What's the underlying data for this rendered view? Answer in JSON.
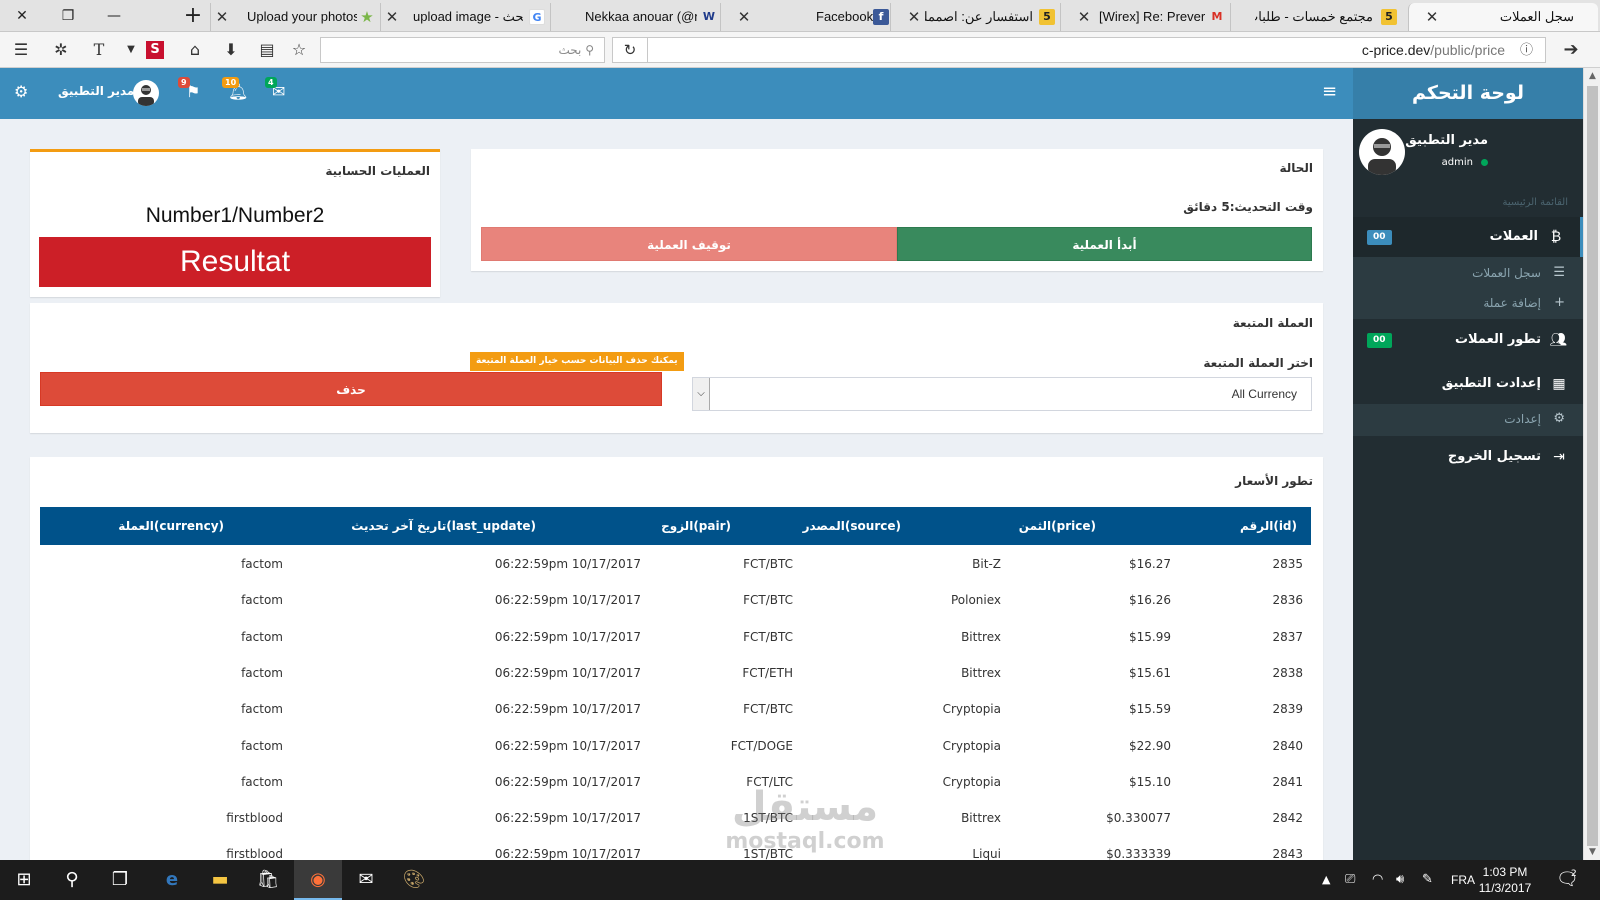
{
  "browser": {
    "tabs": [
      {
        "title": "سجل العملات",
        "active": true
      },
      {
        "title": "مجتمع خمسات - طلبات",
        "favicon": "5"
      },
      {
        "title": "[Wirex] Re: Preverifica",
        "favicon": "M"
      },
      {
        "title": "استفسار عن: اصمملك",
        "favicon": "5"
      },
      {
        "title": "Facebook",
        "favicon": "f"
      },
      {
        "title": "Nekkaa anouar (@ne",
        "favicon": "W"
      },
      {
        "title": "upload image - بحث",
        "favicon": "G"
      },
      {
        "title": "Upload your photos",
        "favicon": "★"
      }
    ],
    "search_placeholder": "بحث",
    "url_main": "c-price.dev",
    "url_path": "/public/price"
  },
  "header": {
    "user_name": "مدير التطبيق",
    "badges": {
      "messages": "4",
      "notifications": "10",
      "flags": "9"
    }
  },
  "brand": "لوحة التحكم",
  "sidebar": {
    "user_name": "مدير التطبيق",
    "user_role": "admin",
    "section_heading": "القائمة الرئيسية",
    "items": [
      {
        "label": "العملات",
        "badge": "00",
        "badge_color": "#3c8dbc"
      },
      {
        "label": "سجل العملات"
      },
      {
        "label": "إضافة عملة"
      },
      {
        "label": "تطور العملات",
        "badge": "00",
        "badge_color": "#00a65a"
      },
      {
        "label": "إعدادت التطبيق"
      },
      {
        "label": "إعدادت"
      },
      {
        "label": "تسجيل الخروج"
      }
    ]
  },
  "calc": {
    "title": "العمليات الحسابية",
    "expression": "Number1/Number2",
    "result": "Resultat"
  },
  "status": {
    "title": "الحالة",
    "update_time": "وقت التحديث:5 دقائق",
    "start_label": "أبدأ العملية",
    "stop_label": "توقيف العملية"
  },
  "follow": {
    "title": "العملة المتبعة",
    "select_label": "اختر العملة المتبعة",
    "select_value": "All Currency",
    "delete_label": "حذف",
    "delete_hint": "يمكنك حذف البيانات حسب خيار العملة المتبعة"
  },
  "prices": {
    "title": "تطور الأسعار",
    "columns": {
      "id": "الرقم(id)",
      "price": "الثمن(price)",
      "source": "المصدر(source)",
      "pair": "الزوج(pair)",
      "last_update": "تاريخ آخر تحديث(last_update)",
      "currency": "العملة(currency)"
    },
    "rows": [
      {
        "id": "2835",
        "price": "$16.27",
        "source": "Bit-Z",
        "pair": "FCT/BTC",
        "last_update": "06:22:59pm 10/17/2017",
        "currency": "factom"
      },
      {
        "id": "2836",
        "price": "$16.26",
        "source": "Poloniex",
        "pair": "FCT/BTC",
        "last_update": "06:22:59pm 10/17/2017",
        "currency": "factom"
      },
      {
        "id": "2837",
        "price": "$15.99",
        "source": "Bittrex",
        "pair": "FCT/BTC",
        "last_update": "06:22:59pm 10/17/2017",
        "currency": "factom"
      },
      {
        "id": "2838",
        "price": "$15.61",
        "source": "Bittrex",
        "pair": "FCT/ETH",
        "last_update": "06:22:59pm 10/17/2017",
        "currency": "factom"
      },
      {
        "id": "2839",
        "price": "$15.59",
        "source": "Cryptopia",
        "pair": "FCT/BTC",
        "last_update": "06:22:59pm 10/17/2017",
        "currency": "factom"
      },
      {
        "id": "2840",
        "price": "$22.90",
        "source": "Cryptopia",
        "pair": "FCT/DOGE",
        "last_update": "06:22:59pm 10/17/2017",
        "currency": "factom"
      },
      {
        "id": "2841",
        "price": "$15.10",
        "source": "Cryptopia",
        "pair": "FCT/LTC",
        "last_update": "06:22:59pm 10/17/2017",
        "currency": "factom"
      },
      {
        "id": "2842",
        "price": "$0.330077",
        "source": "Bittrex",
        "pair": "1ST/BTC",
        "last_update": "06:22:59pm 10/17/2017",
        "currency": "firstblood"
      },
      {
        "id": "2843",
        "price": "$0.333339",
        "source": "Liqui",
        "pair": "1ST/BTC",
        "last_update": "06:22:59pm 10/17/2017",
        "currency": "firstblood"
      }
    ]
  },
  "watermark": {
    "line1": "مستقل",
    "line2": "mostaql.com"
  },
  "taskbar": {
    "lang": "FRA",
    "time": "1:03 PM",
    "date": "11/3/2017",
    "notif_count": "2"
  },
  "colors": {
    "header": "#3c8dbc",
    "sidebar": "#222d32",
    "start": "#398a5d",
    "stop": "#e8847c",
    "delete": "#dd4b39",
    "result": "#cc1f27",
    "table_head": "#00528a"
  }
}
